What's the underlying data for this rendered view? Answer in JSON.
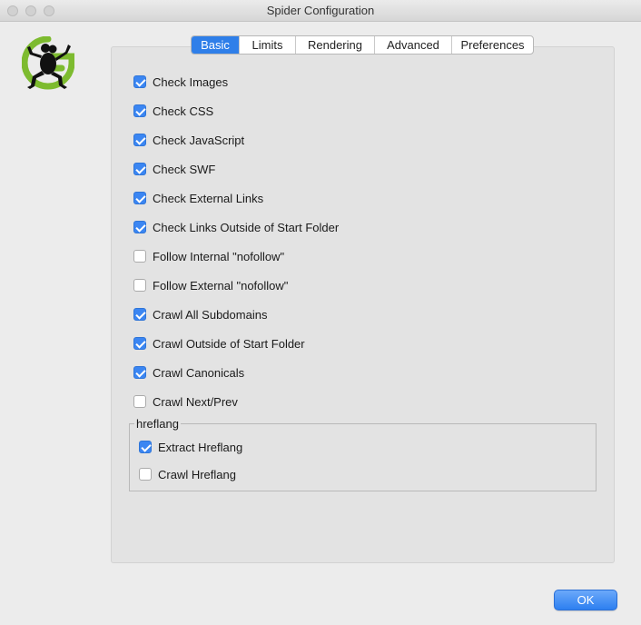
{
  "window": {
    "title": "Spider Configuration"
  },
  "tabs": [
    {
      "label": "Basic",
      "active": true
    },
    {
      "label": "Limits",
      "active": false
    },
    {
      "label": "Rendering",
      "active": false
    },
    {
      "label": "Advanced",
      "active": false
    },
    {
      "label": "Preferences",
      "active": false
    }
  ],
  "options": [
    {
      "label": "Check Images",
      "checked": true
    },
    {
      "label": "Check CSS",
      "checked": true
    },
    {
      "label": "Check JavaScript",
      "checked": true
    },
    {
      "label": "Check SWF",
      "checked": true
    },
    {
      "label": "Check External Links",
      "checked": true
    },
    {
      "label": "Check Links Outside of Start Folder",
      "checked": true
    },
    {
      "label": "Follow Internal \"nofollow\"",
      "checked": false
    },
    {
      "label": "Follow External \"nofollow\"",
      "checked": false
    },
    {
      "label": "Crawl All Subdomains",
      "checked": true
    },
    {
      "label": "Crawl Outside of Start Folder",
      "checked": true
    },
    {
      "label": "Crawl Canonicals",
      "checked": true
    },
    {
      "label": "Crawl Next/Prev",
      "checked": false
    }
  ],
  "hreflang": {
    "legend": "hreflang",
    "options": [
      {
        "label": "Extract Hreflang",
        "checked": true
      },
      {
        "label": "Crawl Hreflang",
        "checked": false
      }
    ]
  },
  "footer": {
    "ok_label": "OK"
  },
  "colors": {
    "accent": "#2f7fe9",
    "logo_green": "#7dbb2f"
  }
}
